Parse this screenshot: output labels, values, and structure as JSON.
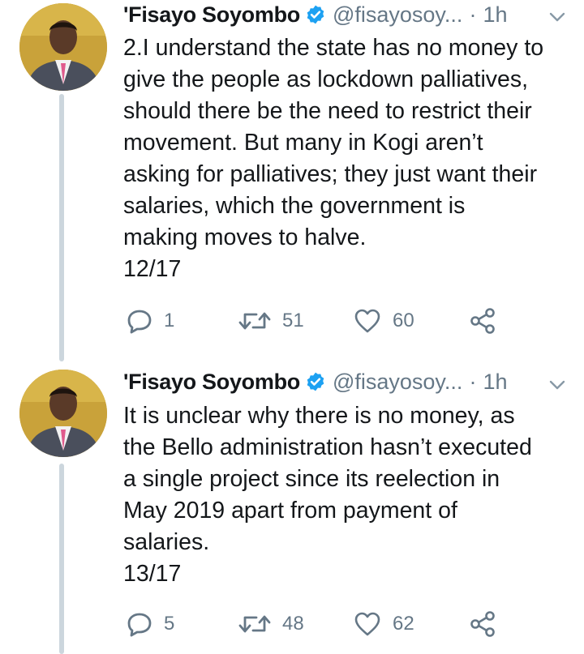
{
  "colors": {
    "text": "#14171a",
    "secondary": "#657786",
    "verified": "#1da1f2",
    "thread_line": "#ccd6dd",
    "avatar_bg": "#c9a23a"
  },
  "tweets": [
    {
      "name": "'Fisayo Soyombo",
      "verified_icon": "verified-badge-icon",
      "handle": "@fisayosoy...",
      "separator": "·",
      "time": "1h",
      "menu_icon": "chevron-down-icon",
      "text": "2.I understand the state has no money to\ngive the people as lockdown palliatives,\nshould there be the need to restrict their\nmovement. But many in Kogi aren’t\nasking for palliatives; they just want their\nsalaries, which the government is\nmaking moves to halve.\n12/17",
      "replies": "1",
      "retweets": "51",
      "likes": "60"
    },
    {
      "name": "'Fisayo Soyombo",
      "verified_icon": "verified-badge-icon",
      "handle": "@fisayosoy...",
      "separator": "·",
      "time": "1h",
      "menu_icon": "chevron-down-icon",
      "text": "It is unclear why there is no money, as\nthe Bello administration hasn’t executed\na single project since its reelection in\nMay 2019 apart from payment of\nsalaries.\n13/17",
      "replies": "5",
      "retweets": "48",
      "likes": "62"
    }
  ]
}
